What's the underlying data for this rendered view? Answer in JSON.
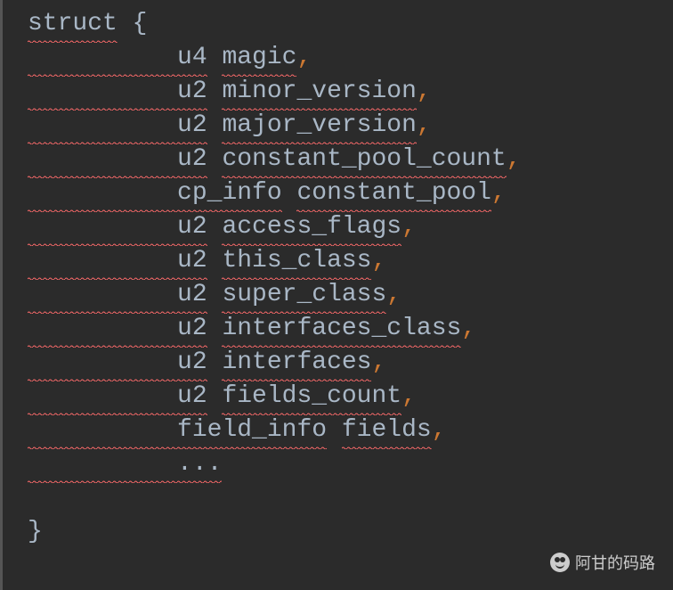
{
  "code": {
    "line1": {
      "keyword": "struct",
      "brace": " {"
    },
    "fields": [
      {
        "type": "u4",
        "name": "magic"
      },
      {
        "type": "u2",
        "name": "minor_version"
      },
      {
        "type": "u2",
        "name": "major_version"
      },
      {
        "type": "u2",
        "name": "constant_pool_count"
      },
      {
        "type": "cp_info",
        "name": "constant_pool"
      },
      {
        "type": "u2",
        "name": "access_flags"
      },
      {
        "type": "u2",
        "name": "this_class"
      },
      {
        "type": "u2",
        "name": "super_class"
      },
      {
        "type": "u2",
        "name": "interfaces_class"
      },
      {
        "type": "u2",
        "name": "interfaces"
      },
      {
        "type": "u2",
        "name": "fields_count"
      },
      {
        "type": "field_info",
        "name": "fields"
      }
    ],
    "ellipsis": "...",
    "closing_brace": "}",
    "comma": ",",
    "indent": "          "
  },
  "watermark": {
    "text": "阿甘的码路"
  }
}
